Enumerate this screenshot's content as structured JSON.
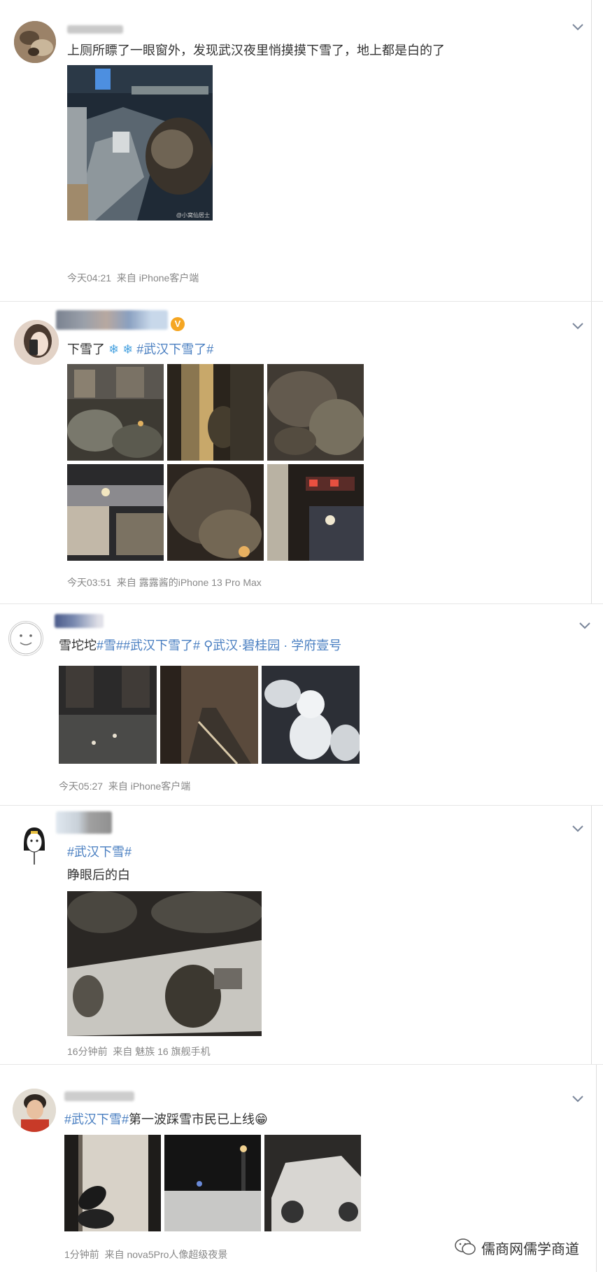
{
  "posts": [
    {
      "text": "上厕所瞟了一眼窗外，发现武汉夜里悄摸摸下雪了，地上都是白的了",
      "time": "今天04:21",
      "source_prefix": "来自",
      "source": "iPhone客户端",
      "photo_watermark": "@小窝仙居士"
    },
    {
      "text_plain": "下雪了",
      "text_icons": "❄ ❄",
      "tag": "#武汉下雪了#",
      "time": "今天03:51",
      "source_prefix": "来自",
      "source": "露露酱的iPhone 13 Pro Max"
    },
    {
      "text_plain": "雪坨坨",
      "tags": "#雪##武汉下雪了#",
      "location": "武汉·碧桂园 · 学府壹号",
      "time": "今天05:27",
      "source_prefix": "来自",
      "source": "iPhone客户端"
    },
    {
      "tag": "#武汉下雪#",
      "text": "睁眼后的白",
      "time": "16分钟前",
      "source_prefix": "来自",
      "source": "魅族 16 旗舰手机"
    },
    {
      "tag": "#武汉下雪#",
      "text": "第一波踩雪市民已上线",
      "emoji": "😁",
      "time": "1分钟前",
      "source_prefix": "来自",
      "source": "nova5Pro人像超级夜景"
    }
  ],
  "watermark": {
    "text": "儒商网儒学商道"
  },
  "colors": {
    "link": "#4a7fc1",
    "meta": "#888888",
    "chevron": "#7a869a"
  }
}
